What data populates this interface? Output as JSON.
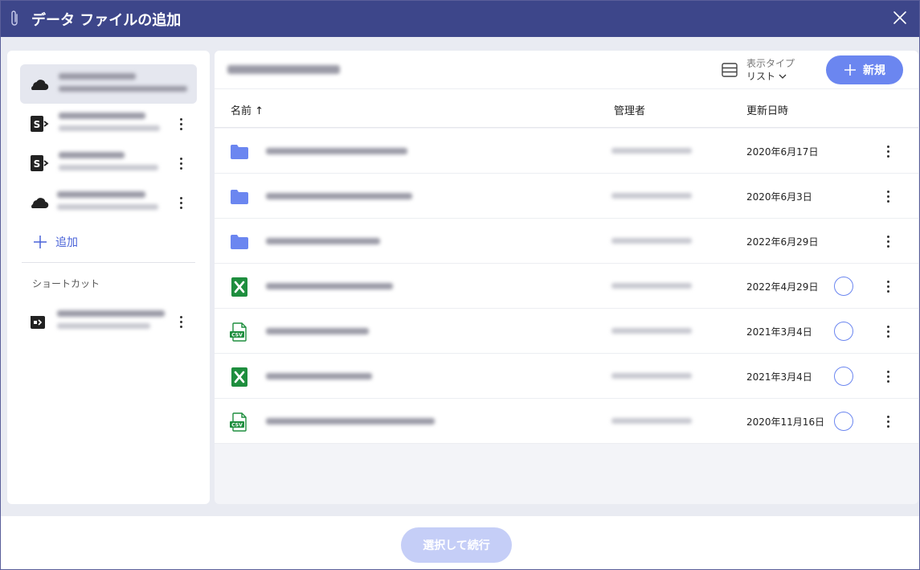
{
  "window": {
    "title": "データ ファイルの追加"
  },
  "sources": [
    {
      "icon": "onedrive-cloud-icon",
      "selected": true
    },
    {
      "icon": "sharepoint-icon",
      "selected": false
    },
    {
      "icon": "sharepoint-icon",
      "selected": false
    },
    {
      "icon": "onedrive-cloud-icon",
      "selected": false
    }
  ],
  "add_source_label": "追加",
  "shortcuts": {
    "heading": "ショートカット"
  },
  "main": {
    "view_type_label": "表示タイプ",
    "view_type_value": "リスト",
    "new_button_label": "新規",
    "columns": {
      "name": "名前 ↑",
      "owner": "管理者",
      "modified": "更新日時"
    },
    "rows": [
      {
        "type": "folder",
        "modified": "2020年6月17日",
        "selectable": false
      },
      {
        "type": "folder",
        "modified": "2020年6月3日",
        "selectable": false
      },
      {
        "type": "folder",
        "modified": "2022年6月29日",
        "selectable": false
      },
      {
        "type": "excel",
        "modified": "2022年4月29日",
        "selectable": true
      },
      {
        "type": "csv",
        "modified": "2021年3月4日",
        "selectable": true
      },
      {
        "type": "excel",
        "modified": "2021年3月4日",
        "selectable": true
      },
      {
        "type": "csv",
        "modified": "2020年11月16日",
        "selectable": true
      }
    ]
  },
  "footer": {
    "continue_label": "選択して続行"
  },
  "colors": {
    "titlebar": "#3d468a",
    "accent": "#6b86f0",
    "folder": "#6b86f0",
    "excel": "#1e8e3e",
    "disabled_button": "#c5cef7"
  }
}
